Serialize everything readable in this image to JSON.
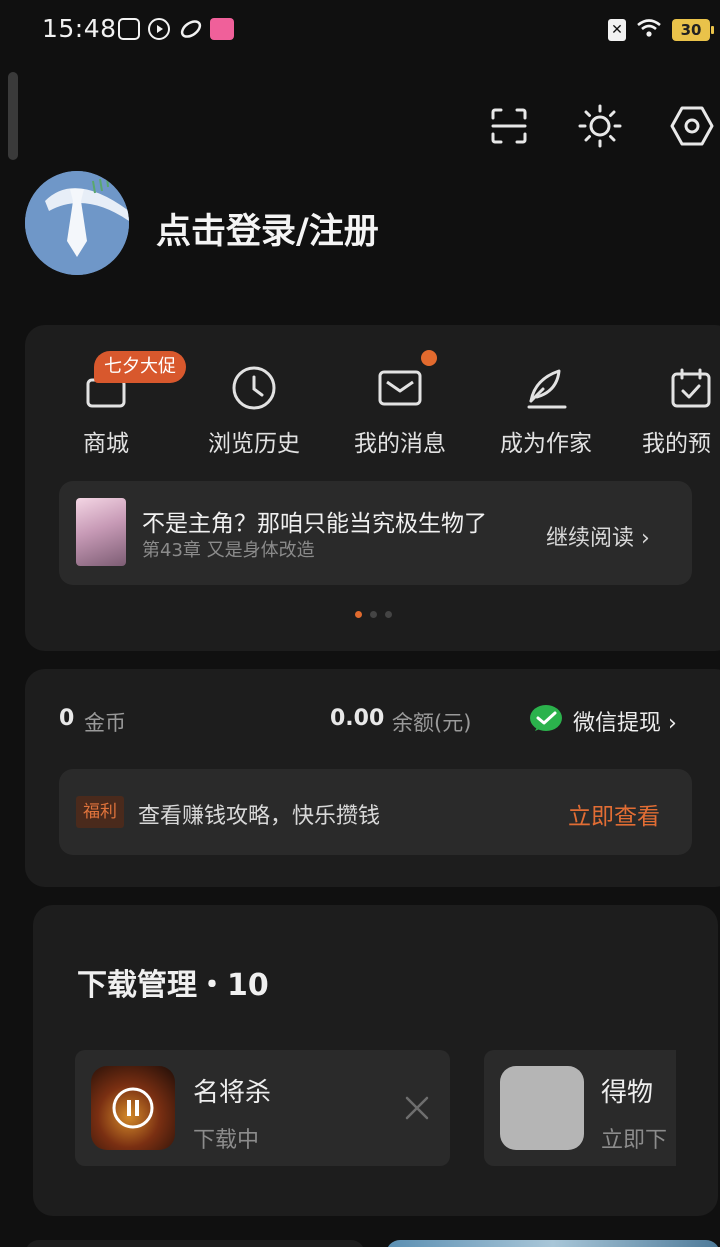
{
  "status_bar": {
    "time": "15:48",
    "battery_level": "30",
    "icons": [
      "notification-app-icon",
      "play-icon",
      "leaf-app-icon",
      "bilibili-icon",
      "sim-off-icon",
      "wifi-icon",
      "battery-icon"
    ]
  },
  "header_icons": [
    "scan-icon",
    "brightness-icon",
    "settings-icon"
  ],
  "profile": {
    "login_text": "点击登录/注册"
  },
  "shortcuts": {
    "promo_badge": "七夕大促",
    "items": [
      {
        "label": "商城",
        "icon": "shop-bag-icon"
      },
      {
        "label": "浏览历史",
        "icon": "clock-icon"
      },
      {
        "label": "我的消息",
        "icon": "mail-icon"
      },
      {
        "label": "成为作家",
        "icon": "quill-pen-icon"
      },
      {
        "label": "我的预",
        "icon": "calendar-check-icon"
      }
    ]
  },
  "recent_read": {
    "title": "不是主角？那咱只能当究极生物了",
    "chapter": "第43章 又是身体改造",
    "continue_label": "继续阅读 ›"
  },
  "wallet": {
    "coins_value": "0",
    "coins_label": "金币",
    "balance_value": "0.00",
    "balance_label": "余额(元)",
    "withdraw_label": "微信提现 ›",
    "welfare_tag": "福利",
    "welfare_text": "查看赚钱攻略，快乐攒钱",
    "welfare_link": "立即查看"
  },
  "downloads": {
    "title": "下载管理・10",
    "items": [
      {
        "name": "名将杀",
        "status": "下载中"
      },
      {
        "name": "得物",
        "status": "立即下"
      }
    ]
  },
  "colors": {
    "background": "#101010",
    "card": "#1d1d1d",
    "accent": "#e26d34",
    "wechat_green": "#2bb24c"
  }
}
